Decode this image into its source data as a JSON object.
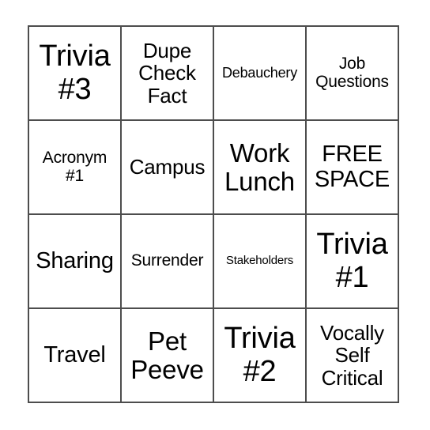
{
  "card": {
    "type": "bingo-card",
    "columns": 4,
    "rows": 4,
    "border_color": "#4d4d4d",
    "cell_background": "#ffffff",
    "text_color": "#000000",
    "cells": [
      {
        "text": "Trivia\n#3",
        "size": "xxl"
      },
      {
        "text": "Dupe\nCheck\nFact",
        "size": "md"
      },
      {
        "text": "Debauchery",
        "size": "xs"
      },
      {
        "text": "Job\nQuestions",
        "size": "sm"
      },
      {
        "text": "Acronym\n#1",
        "size": "sm"
      },
      {
        "text": "Campus",
        "size": "md"
      },
      {
        "text": "Work\nLunch",
        "size": "xl"
      },
      {
        "text": "FREE\nSPACE",
        "size": "lg"
      },
      {
        "text": "Sharing",
        "size": "lg"
      },
      {
        "text": "Surrender",
        "size": "sm"
      },
      {
        "text": "Stakeholders",
        "size": "xxs"
      },
      {
        "text": "Trivia\n#1",
        "size": "xxl"
      },
      {
        "text": "Travel",
        "size": "lg"
      },
      {
        "text": "Pet\nPeeve",
        "size": "xl"
      },
      {
        "text": "Trivia\n#2",
        "size": "xxl"
      },
      {
        "text": "Vocally\nSelf\nCritical",
        "size": "md"
      }
    ]
  }
}
